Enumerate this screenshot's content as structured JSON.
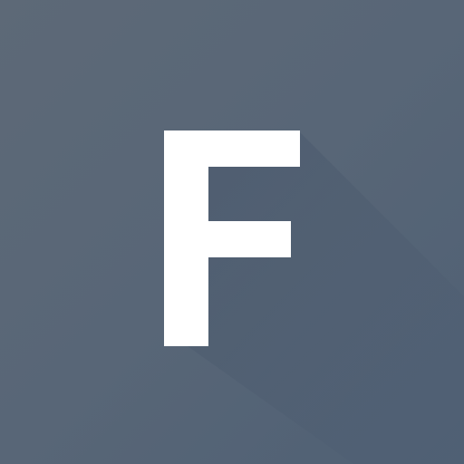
{
  "icon": {
    "name": "letter-f-app-icon",
    "letter": "F",
    "colors": {
      "background_light": "#5d6977",
      "background_dark": "#4f6074",
      "glyph": "#ffffff",
      "long_shadow": "#4a596b"
    }
  }
}
